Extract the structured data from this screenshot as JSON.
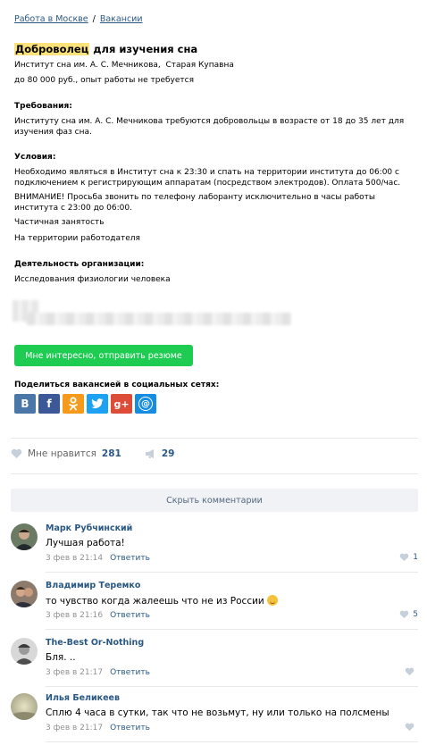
{
  "breadcrumb": {
    "item1": "Работа в Москве",
    "separator": "/",
    "item2": "Вакансии"
  },
  "vacancy": {
    "title_highlight": "Доброволец",
    "title_rest": " для изучения сна",
    "employer": "Институт сна им. А. С. Мечникова,",
    "location": "Старая Купавна",
    "salary": "до 80 000 руб., опыт работы не требуется",
    "requirements_heading": "Требования:",
    "requirements_text": "Институту сна им. А. С. Мечникова требуются добровольцы в возрасте от 18 до 35 лет для изучения фаз сна.",
    "conditions_heading": "Условия:",
    "conditions_text1": "Необходимо являться в Институт сна к 23:30 и спать на территории института до 06:00 с подключением к регистрирующим аппаратам (посредством электродов). Оплата 500/час.",
    "conditions_text2": "ВНИМАНИЕ! Просьба звонить по телефону лаборанту исключительно в часы работы института с 23:00 до 06:00.",
    "employment_type": "Частичная занятость",
    "workplace": "На территории работодателя",
    "activity_heading": "Деятельность организации:",
    "activity_text": "Исследования физиологии человека",
    "apply_button": "Мне интересно, отправить резюме"
  },
  "share": {
    "label": "Поделиться вакансией в социальных сетях:",
    "buttons": [
      {
        "name": "vk",
        "glyph": "В",
        "color": "#4a76a8"
      },
      {
        "name": "facebook",
        "glyph": "f",
        "color": "#3b5998"
      },
      {
        "name": "odnoklassniki",
        "glyph": "ок",
        "color": "#f59a1b"
      },
      {
        "name": "twitter",
        "glyph": "🐦",
        "color": "#1da1f2"
      },
      {
        "name": "googleplus",
        "glyph": "g+",
        "color": "#dd4b39"
      },
      {
        "name": "mail",
        "glyph": "@",
        "color": "#168de2"
      }
    ]
  },
  "post_actions": {
    "like_label": "Мне нравится",
    "like_count": "281",
    "share_count": "29"
  },
  "comments_toggle": "Скрыть комментарии",
  "comments": [
    {
      "author": "Марк Рубчинский",
      "text": "Лучшая работа!",
      "date": "3 фев в 21:14",
      "reply": "Ответить",
      "likes": "1",
      "avatar": "#3c4a3a"
    },
    {
      "author": "Владимир Теремко",
      "text": "то чувство когда жалеешь что не из России",
      "date": "3 фев в 21:16",
      "reply": "Ответить",
      "likes": "5",
      "avatar": "#5a4a44"
    },
    {
      "author": "The-Best Or-Nothing",
      "text": "Бля. ..",
      "date": "3 фев в 21:17",
      "reply": "Ответить",
      "likes": "",
      "avatar": "#8a8a8a"
    },
    {
      "author": "Илья Беликеев",
      "text": "Сплю 4 часа в сутки, так что не возьмут, ну или только на полсмены",
      "date": "3 фев в 21:17",
      "reply": "Ответить",
      "likes": "",
      "avatar": "#b9b69a"
    }
  ]
}
